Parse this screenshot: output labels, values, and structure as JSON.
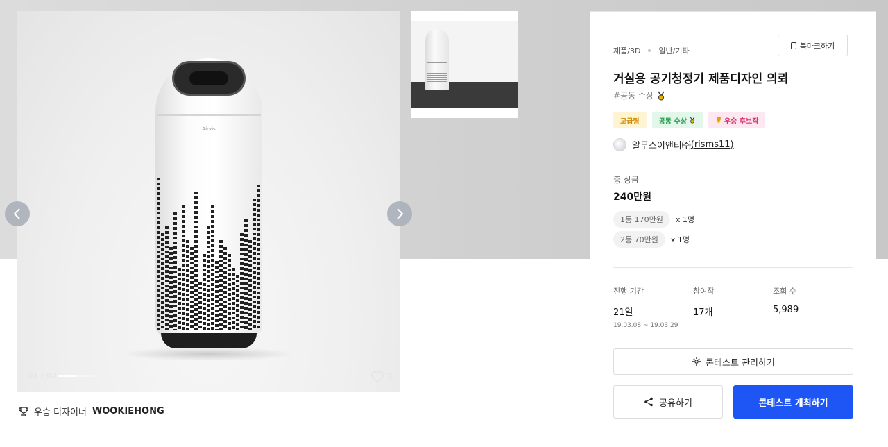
{
  "gallery": {
    "counter": "01 / 02",
    "progress_fraction": 0.5,
    "likes": "8",
    "thumbnail_count": 1
  },
  "designer": {
    "prefix": "우승 디자이너",
    "name": "WOOKIEHONG"
  },
  "panel": {
    "category_main": "제품/3D",
    "category_sub": "일반/기타",
    "bookmark_label": "북마크하기",
    "title": "거실용 공기청정기 제품디자인 의뢰",
    "tagline": "#공동 수상",
    "badges": [
      {
        "label": "고급형",
        "color": "#d08a00"
      },
      {
        "label": "공동 수상",
        "color": "#1f9a4a"
      },
      {
        "label": "우승 후보작",
        "color": "#d6336c"
      }
    ],
    "host_name": "알무스이앤티㈜",
    "host_id": "(risms11)",
    "prize_label": "총 상금",
    "prize_total": "240만원",
    "prizes": [
      {
        "rank": "1등 170만원",
        "count": "x 1명"
      },
      {
        "rank": "2등 70만원",
        "count": "x 1명"
      }
    ],
    "stats": {
      "period_label": "진행 기간",
      "period_value": "21일",
      "period_range": "19.03.08 ~ 19.03.29",
      "participants_label": "참여작",
      "participants_value": "17개",
      "views_label": "조회 수",
      "views_value": "5,989"
    },
    "manage_label": "콘테스트 관리하기",
    "share_label": "공유하기",
    "host_button_label": "콘테스트 개최하기"
  },
  "colors": {
    "primary": "#1e56f5",
    "badge_yellow": "#fff4d1",
    "badge_green": "#e2f6ea",
    "badge_pink": "#fde8f1"
  }
}
